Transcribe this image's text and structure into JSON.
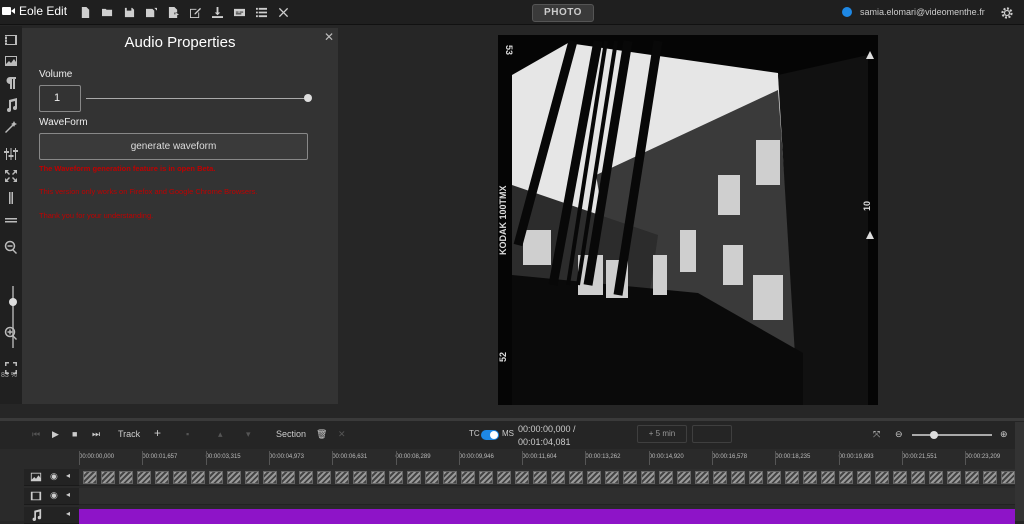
{
  "app": {
    "title": "Eole Edit"
  },
  "toolbar": {
    "icons": [
      "file-icon",
      "folder-open-icon",
      "save-icon",
      "save-as-icon",
      "export-icon",
      "edit-icon",
      "download-icon",
      "subtitle-icon",
      "list-icon",
      "close-icon"
    ],
    "mode_label": "PHOTO",
    "user_email": "samia.elomari@videomenthe.fr"
  },
  "left_tools": {
    "zoom_level": "83 %"
  },
  "audio_panel": {
    "title": "Audio Properties",
    "volume_label": "Volume",
    "volume_value": "1",
    "volume_level": 1.0,
    "waveform_label": "WaveForm",
    "generate_button": "generate waveform",
    "notice_bold": "The Waveform generation feature is in open Beta.",
    "notice_browsers": "This version only works on Firefox and Google Chrome Browsers.",
    "notice_thanks": "Thank you for your understanding."
  },
  "preview": {
    "film_text_left": "KODAK 100TMX",
    "frame_top": "53",
    "frame_bottom": "52",
    "frame_right": "10"
  },
  "timeline": {
    "track_label": "Track",
    "section_label": "Section",
    "tc_label": "TC",
    "ms_label": "MS",
    "current_time": "00:00:00,000 /",
    "total_time": "00:01:04,081",
    "step_label": "+ 5 min",
    "ruler": [
      "00:00:00,000",
      "00:00:01,657",
      "00:00:03,315",
      "00:00:04,973",
      "00:00:06,631",
      "00:00:08,289",
      "00:00:09,946",
      "00:00:11,604",
      "00:00:13,262",
      "00:00:14,920",
      "00:00:16,578",
      "00:00:18,235",
      "00:00:19,893",
      "00:00:21,551",
      "00:00:23,209"
    ],
    "zoom_level": 0.3,
    "colors": {
      "audio_track": "#8e14c8",
      "toggle": "#1e88e5"
    }
  }
}
